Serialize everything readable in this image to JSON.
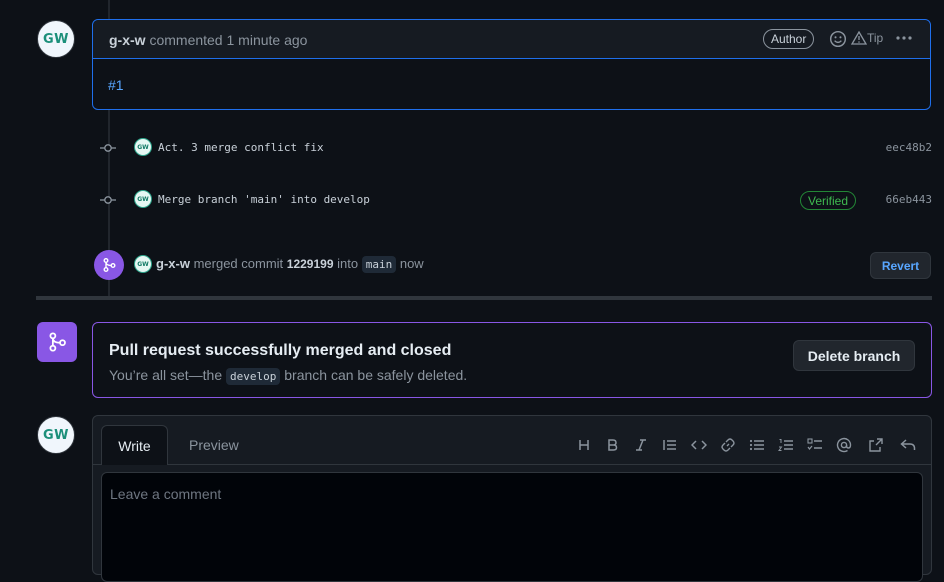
{
  "comment": {
    "author": "g-x-w",
    "action": "commented",
    "time": "1 minute ago",
    "badge": "Author",
    "tip": "Tip",
    "body": "#1",
    "avatar_initials": "GW"
  },
  "commits": [
    {
      "message": "Act. 3 merge conflict fix",
      "sha": "eec48b2",
      "verified": ""
    },
    {
      "message": "Merge branch 'main' into develop",
      "sha": "66eb443",
      "verified": "Verified"
    }
  ],
  "merge_event": {
    "actor": "g-x-w",
    "text1": "merged commit",
    "commit": "1229199",
    "text2": "into",
    "branch": "main",
    "text3": "now",
    "revert_label": "Revert"
  },
  "merged_notice": {
    "title": "Pull request successfully merged and closed",
    "sub_before": "You’re all set—the",
    "branch": "develop",
    "sub_after": "branch can be safely deleted.",
    "delete_label": "Delete branch"
  },
  "editor": {
    "tab_write": "Write",
    "tab_preview": "Preview",
    "placeholder": "Leave a comment",
    "avatar_initials": "GW"
  },
  "colors": {
    "merged_purple": "#8957e5",
    "link_blue": "#58a6ff",
    "verified_green": "#3fb950"
  }
}
